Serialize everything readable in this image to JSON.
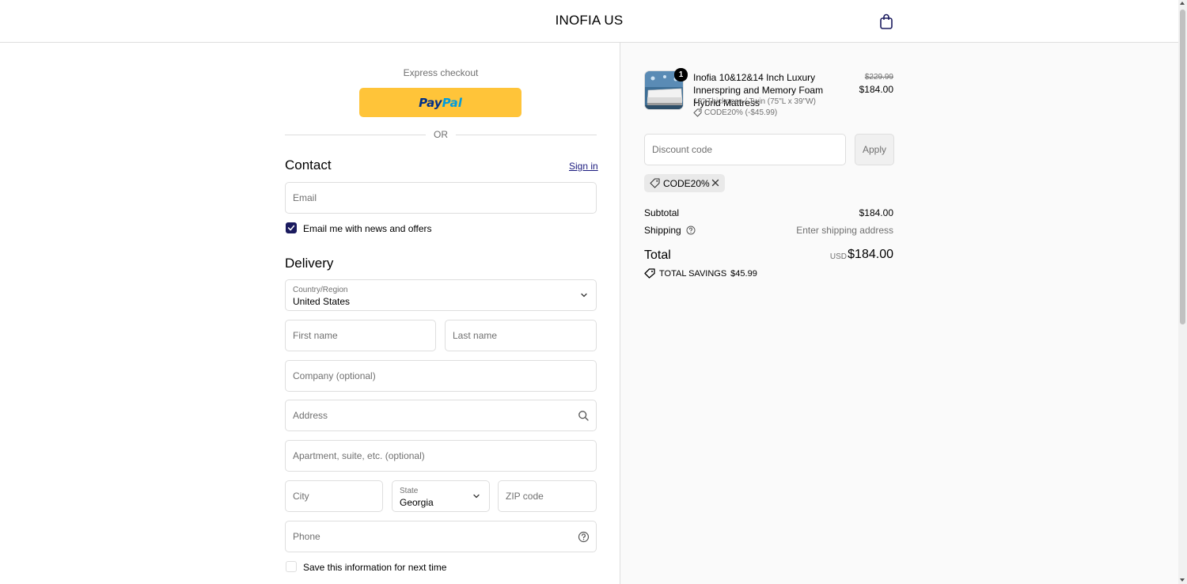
{
  "header": {
    "store_name": "INOFIA US"
  },
  "express": {
    "label": "Express checkout",
    "paypal_part1": "Pay",
    "paypal_part2": "Pal",
    "or_text": "OR"
  },
  "contact": {
    "title": "Contact",
    "sign_in": "Sign in",
    "email_placeholder": "Email",
    "newsletter_label": "Email me with news and offers",
    "newsletter_checked": true
  },
  "delivery": {
    "title": "Delivery",
    "country_label": "Country/Region",
    "country_value": "United States",
    "first_name_placeholder": "First name",
    "last_name_placeholder": "Last name",
    "company_placeholder": "Company (optional)",
    "address_placeholder": "Address",
    "apartment_placeholder": "Apartment, suite, etc. (optional)",
    "city_placeholder": "City",
    "state_label": "State",
    "state_value": "Georgia",
    "zip_placeholder": "ZIP code",
    "phone_placeholder": "Phone",
    "save_info_label": "Save this information for next time",
    "save_info_checked": false
  },
  "order": {
    "item": {
      "quantity": "1",
      "title": "Inofia 10&12&14 Inch Luxury Innerspring and Memory Foam Hybrid Mattress",
      "variant": "10\" Thickness / Twin (75\"L x 39\"W)",
      "discount_line": "CODE20% (-$45.99)",
      "original_price": "$229.99",
      "price": "$184.00"
    },
    "discount_placeholder": "Discount code",
    "apply_label": "Apply",
    "applied_code": "CODE20%",
    "subtotal_label": "Subtotal",
    "subtotal_value": "$184.00",
    "shipping_label": "Shipping",
    "shipping_value": "Enter shipping address",
    "total_label": "Total",
    "total_currency": "USD",
    "total_value": "$184.00",
    "savings_label": "TOTAL SAVINGS",
    "savings_value": "$45.99"
  },
  "colors": {
    "accent": "#1a1a5e",
    "paypal_yellow": "#ffc439",
    "paypal_dark_blue": "#003087",
    "paypal_light_blue": "#009cde",
    "border": "#dedede",
    "muted_text": "#707070"
  },
  "icons": [
    "shopping-bag-icon",
    "chevron-down-icon",
    "search-icon",
    "help-circle-icon",
    "tag-icon",
    "close-icon",
    "checkmark-icon"
  ]
}
